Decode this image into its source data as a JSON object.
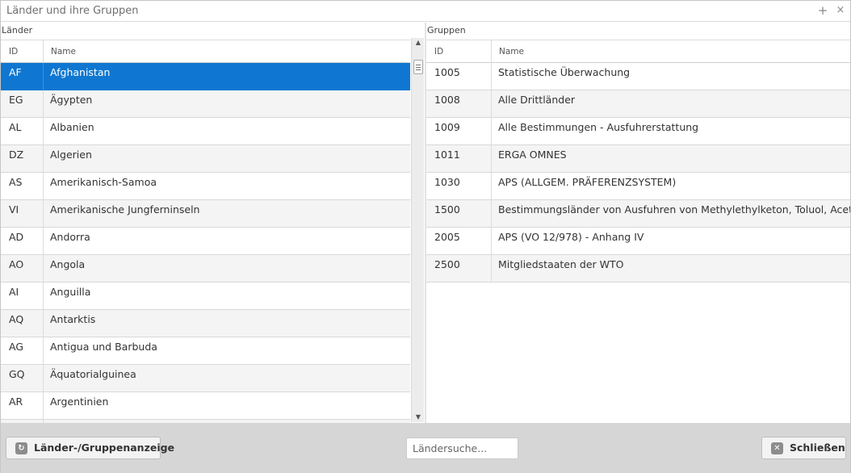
{
  "window": {
    "title": "Länder und ihre Gruppen",
    "maximize_icon": "+",
    "close_icon": "×"
  },
  "countries_panel": {
    "label": "Länder",
    "columns": {
      "id": "ID",
      "name": "Name"
    },
    "selected_index": 0,
    "rows": [
      {
        "id": "AF",
        "name": "Afghanistan"
      },
      {
        "id": "EG",
        "name": "Ägypten"
      },
      {
        "id": "AL",
        "name": "Albanien"
      },
      {
        "id": "DZ",
        "name": "Algerien"
      },
      {
        "id": "AS",
        "name": "Amerikanisch-Samoa"
      },
      {
        "id": "VI",
        "name": "Amerikanische Jungferninseln"
      },
      {
        "id": "AD",
        "name": "Andorra"
      },
      {
        "id": "AO",
        "name": "Angola"
      },
      {
        "id": "AI",
        "name": "Anguilla"
      },
      {
        "id": "AQ",
        "name": "Antarktis"
      },
      {
        "id": "AG",
        "name": "Antigua und Barbuda"
      },
      {
        "id": "GQ",
        "name": "Äquatorialguinea"
      },
      {
        "id": "AR",
        "name": "Argentinien"
      },
      {
        "id": "",
        "name": ""
      }
    ]
  },
  "groups_panel": {
    "label": "Gruppen",
    "columns": {
      "id": "ID",
      "name": "Name"
    },
    "rows": [
      {
        "id": "1005",
        "name": "Statistische Überwachung"
      },
      {
        "id": "1008",
        "name": "Alle Drittländer"
      },
      {
        "id": "1009",
        "name": "Alle Bestimmungen - Ausfuhrerstattung"
      },
      {
        "id": "1011",
        "name": "ERGA OMNES"
      },
      {
        "id": "1030",
        "name": "APS (ALLGEM. PRÄFERENZSYSTEM)"
      },
      {
        "id": "1500",
        "name": "Bestimmungsländer von Ausfuhren von Methylethylketon, Toluol, Aceton und"
      },
      {
        "id": "2005",
        "name": "APS (VO 12/978) - Anhang IV"
      },
      {
        "id": "2500",
        "name": "Mitgliedstaaten der WTO"
      }
    ]
  },
  "footer": {
    "toggle_button": {
      "label": "Länder-/Gruppenanzeige",
      "icon": "toggle-view-icon",
      "glyph": "↻"
    },
    "search": {
      "placeholder": "Ländersuche..."
    },
    "close_button": {
      "label": "Schließen",
      "icon": "close-icon",
      "glyph": "✕"
    }
  },
  "colors": {
    "selection": "#0f77d1",
    "footer_bg": "#d6d6d6"
  }
}
